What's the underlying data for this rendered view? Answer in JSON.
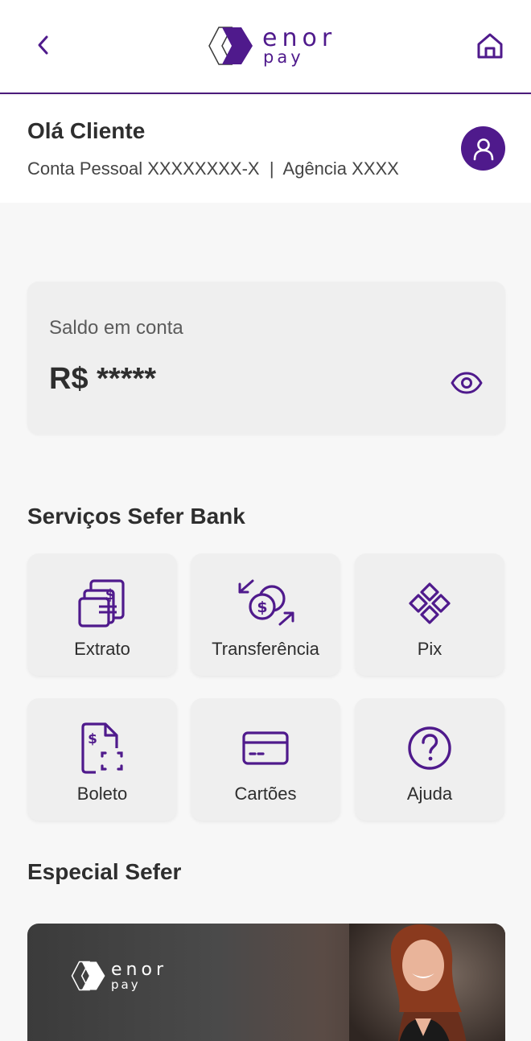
{
  "header": {
    "logo_line1": "enor",
    "logo_line2": "pay"
  },
  "account": {
    "greeting": "Olá Cliente",
    "details": "Conta Pessoal XXXXXXXX-X  |  Agência XXXX"
  },
  "balance": {
    "label": "Saldo em conta",
    "value": "R$ *****"
  },
  "services": {
    "title": "Serviços Sefer Bank",
    "items": [
      {
        "label": "Extrato",
        "icon": "statement-icon"
      },
      {
        "label": "Transferência",
        "icon": "transfer-icon"
      },
      {
        "label": "Pix",
        "icon": "pix-icon"
      },
      {
        "label": "Boleto",
        "icon": "boleto-icon"
      },
      {
        "label": "Cartões",
        "icon": "card-icon"
      },
      {
        "label": "Ajuda",
        "icon": "help-icon"
      }
    ]
  },
  "special": {
    "title": "Especial Sefer",
    "banner_logo_line1": "enor",
    "banner_logo_line2": "pay"
  },
  "colors": {
    "brand": "#4f1a8c",
    "background": "#f7f7f7",
    "card": "#efefef"
  }
}
